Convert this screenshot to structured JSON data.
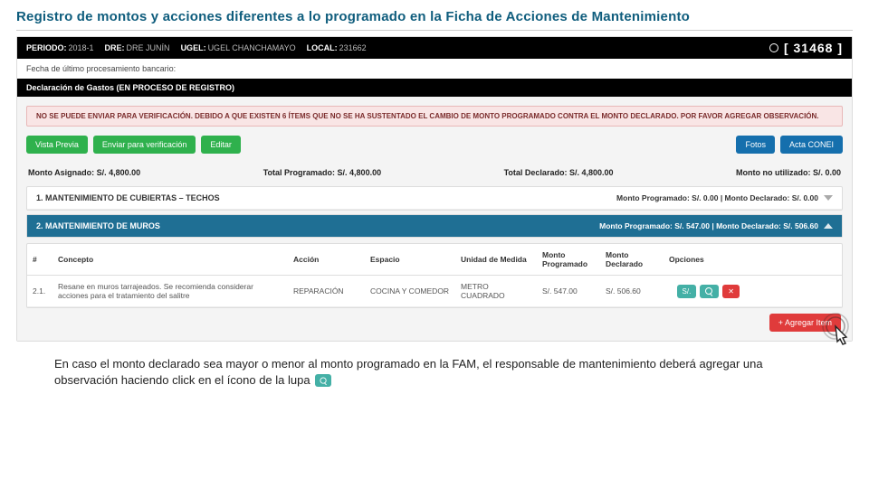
{
  "slide_title": "Registro de montos y acciones diferentes a lo programado en la Ficha de Acciones de Mantenimiento",
  "topbar": {
    "periodo_label": "PERIODO:",
    "periodo_value": "2018-1",
    "dre_label": "DRE:",
    "dre_value": "DRE JUNÍN",
    "ugel_label": "UGEL:",
    "ugel_value": "UGEL CHANCHAMAYO",
    "local_label": "LOCAL:",
    "local_value": "231662",
    "big_number": "[ 31468 ]"
  },
  "infobar": {
    "text": "Fecha de último procesamiento bancario:"
  },
  "section": {
    "title": "Declaración de Gastos (EN PROCESO DE REGISTRO)"
  },
  "warning": {
    "text": "NO SE PUEDE ENVIAR PARA VERIFICACIÓN. DEBIDO A QUE EXISTEN 6 ÍTEMS QUE NO SE HA SUSTENTADO EL CAMBIO DE MONTO PROGRAMADO CONTRA EL MONTO DECLARADO. POR FAVOR AGREGAR OBSERVACIÓN."
  },
  "buttons": {
    "vista_previa": "Vista Previa",
    "enviar": "Enviar para verificación",
    "editar": "Editar",
    "fotos": "Fotos",
    "acta_conei": "Acta CONEI",
    "agregar": "+ Agregar Item",
    "mini_soles": "S/."
  },
  "totals": {
    "monto_asignado": "Monto Asignado: S/. 4,800.00",
    "total_programado": "Total Programado: S/. 4,800.00",
    "total_declarado": "Total Declarado: S/. 4,800.00",
    "monto_no_utilizado": "Monto no utilizado: S/. 0.00"
  },
  "accordions": [
    {
      "title": "1. MANTENIMIENTO DE CUBIERTAS – TECHOS",
      "right": "Monto Programado: S/. 0.00 | Monto Declarado: S/. 0.00"
    },
    {
      "title": "2. MANTENIMIENTO DE MUROS",
      "right": "Monto Programado: S/. 547.00 | Monto Declarado: S/. 506.60"
    }
  ],
  "table": {
    "headers": {
      "n": "#",
      "concepto": "Concepto",
      "accion": "Acción",
      "espacio": "Espacio",
      "unidad": "Unidad de Medida",
      "monto_prog": "Monto Programado",
      "monto_decl": "Monto Declarado",
      "opciones": "Opciones"
    },
    "row": {
      "n": "2.1.",
      "concepto": "Resane en muros tarrajeados. Se recomienda considerar acciones para el tratamiento del salitre",
      "accion": "REPARACIÓN",
      "espacio": "COCINA Y COMEDOR",
      "unidad": "METRO CUADRADO",
      "monto_prog": "S/. 547.00",
      "monto_decl": "S/. 506.60"
    }
  },
  "caption": {
    "text": "En caso el monto declarado sea mayor o menor al monto programado en la FAM, el responsable de mantenimiento deberá agregar una observación haciendo click en el ícono de la lupa"
  }
}
